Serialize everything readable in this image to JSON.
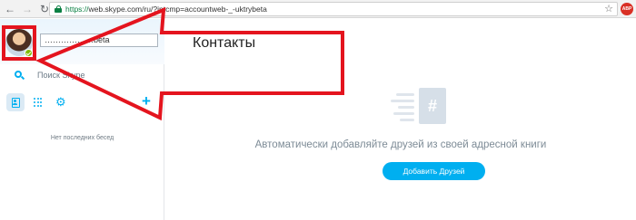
{
  "browser": {
    "url_scheme": "https://",
    "url_rest": "web.skype.com/ru/?intcmp=accountweb-_-uktrybeta",
    "extension_badge": "ABP"
  },
  "sidebar": {
    "profile_name": "………………beta",
    "search_placeholder": "Поиск Skype",
    "empty_recents": "Нет последних бесед"
  },
  "main": {
    "title": "Контакты",
    "empty_state_text": "Автоматически добавляйте друзей из своей адресной книги",
    "add_friends_button": "Добавить Друзей"
  },
  "colors": {
    "accent": "#00aff0",
    "annotation": "#e4141e",
    "presence_online": "#7fba00"
  },
  "icons": [
    "back-icon",
    "forward-icon",
    "reload-icon",
    "lock-icon",
    "star-icon",
    "search-icon",
    "contacts-icon",
    "dialpad-icon",
    "gear-icon",
    "plus-icon",
    "hash-icon"
  ]
}
